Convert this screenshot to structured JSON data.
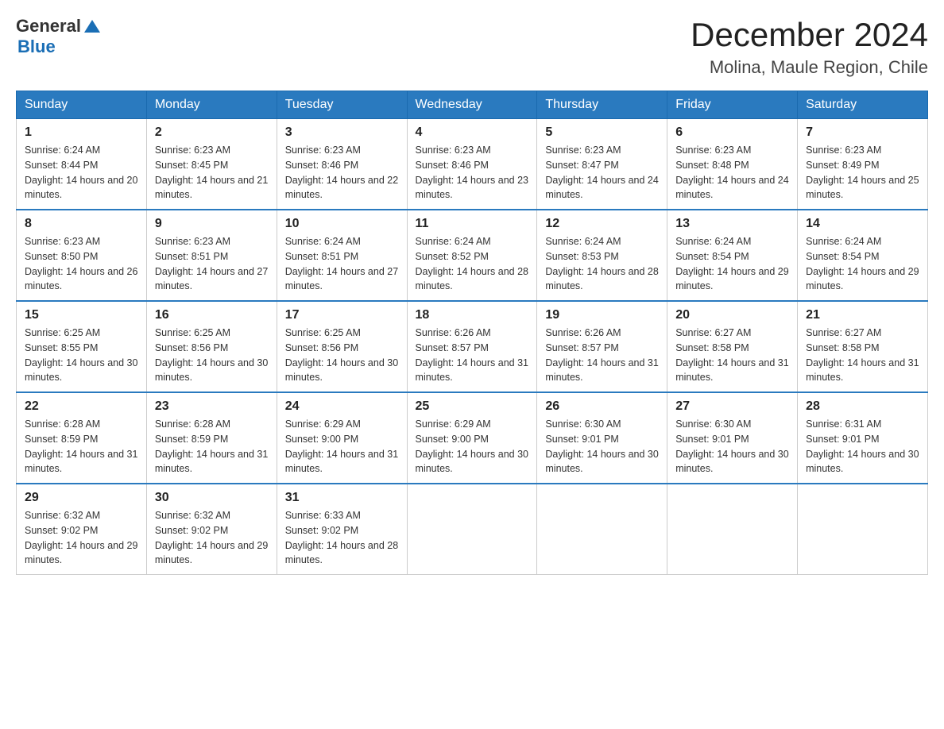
{
  "logo": {
    "text_general": "General",
    "text_blue": "Blue"
  },
  "header": {
    "month_year": "December 2024",
    "location": "Molina, Maule Region, Chile"
  },
  "weekdays": [
    "Sunday",
    "Monday",
    "Tuesday",
    "Wednesday",
    "Thursday",
    "Friday",
    "Saturday"
  ],
  "weeks": [
    [
      {
        "day": "1",
        "sunrise": "6:24 AM",
        "sunset": "8:44 PM",
        "daylight": "14 hours and 20 minutes."
      },
      {
        "day": "2",
        "sunrise": "6:23 AM",
        "sunset": "8:45 PM",
        "daylight": "14 hours and 21 minutes."
      },
      {
        "day": "3",
        "sunrise": "6:23 AM",
        "sunset": "8:46 PM",
        "daylight": "14 hours and 22 minutes."
      },
      {
        "day": "4",
        "sunrise": "6:23 AM",
        "sunset": "8:46 PM",
        "daylight": "14 hours and 23 minutes."
      },
      {
        "day": "5",
        "sunrise": "6:23 AM",
        "sunset": "8:47 PM",
        "daylight": "14 hours and 24 minutes."
      },
      {
        "day": "6",
        "sunrise": "6:23 AM",
        "sunset": "8:48 PM",
        "daylight": "14 hours and 24 minutes."
      },
      {
        "day": "7",
        "sunrise": "6:23 AM",
        "sunset": "8:49 PM",
        "daylight": "14 hours and 25 minutes."
      }
    ],
    [
      {
        "day": "8",
        "sunrise": "6:23 AM",
        "sunset": "8:50 PM",
        "daylight": "14 hours and 26 minutes."
      },
      {
        "day": "9",
        "sunrise": "6:23 AM",
        "sunset": "8:51 PM",
        "daylight": "14 hours and 27 minutes."
      },
      {
        "day": "10",
        "sunrise": "6:24 AM",
        "sunset": "8:51 PM",
        "daylight": "14 hours and 27 minutes."
      },
      {
        "day": "11",
        "sunrise": "6:24 AM",
        "sunset": "8:52 PM",
        "daylight": "14 hours and 28 minutes."
      },
      {
        "day": "12",
        "sunrise": "6:24 AM",
        "sunset": "8:53 PM",
        "daylight": "14 hours and 28 minutes."
      },
      {
        "day": "13",
        "sunrise": "6:24 AM",
        "sunset": "8:54 PM",
        "daylight": "14 hours and 29 minutes."
      },
      {
        "day": "14",
        "sunrise": "6:24 AM",
        "sunset": "8:54 PM",
        "daylight": "14 hours and 29 minutes."
      }
    ],
    [
      {
        "day": "15",
        "sunrise": "6:25 AM",
        "sunset": "8:55 PM",
        "daylight": "14 hours and 30 minutes."
      },
      {
        "day": "16",
        "sunrise": "6:25 AM",
        "sunset": "8:56 PM",
        "daylight": "14 hours and 30 minutes."
      },
      {
        "day": "17",
        "sunrise": "6:25 AM",
        "sunset": "8:56 PM",
        "daylight": "14 hours and 30 minutes."
      },
      {
        "day": "18",
        "sunrise": "6:26 AM",
        "sunset": "8:57 PM",
        "daylight": "14 hours and 31 minutes."
      },
      {
        "day": "19",
        "sunrise": "6:26 AM",
        "sunset": "8:57 PM",
        "daylight": "14 hours and 31 minutes."
      },
      {
        "day": "20",
        "sunrise": "6:27 AM",
        "sunset": "8:58 PM",
        "daylight": "14 hours and 31 minutes."
      },
      {
        "day": "21",
        "sunrise": "6:27 AM",
        "sunset": "8:58 PM",
        "daylight": "14 hours and 31 minutes."
      }
    ],
    [
      {
        "day": "22",
        "sunrise": "6:28 AM",
        "sunset": "8:59 PM",
        "daylight": "14 hours and 31 minutes."
      },
      {
        "day": "23",
        "sunrise": "6:28 AM",
        "sunset": "8:59 PM",
        "daylight": "14 hours and 31 minutes."
      },
      {
        "day": "24",
        "sunrise": "6:29 AM",
        "sunset": "9:00 PM",
        "daylight": "14 hours and 31 minutes."
      },
      {
        "day": "25",
        "sunrise": "6:29 AM",
        "sunset": "9:00 PM",
        "daylight": "14 hours and 30 minutes."
      },
      {
        "day": "26",
        "sunrise": "6:30 AM",
        "sunset": "9:01 PM",
        "daylight": "14 hours and 30 minutes."
      },
      {
        "day": "27",
        "sunrise": "6:30 AM",
        "sunset": "9:01 PM",
        "daylight": "14 hours and 30 minutes."
      },
      {
        "day": "28",
        "sunrise": "6:31 AM",
        "sunset": "9:01 PM",
        "daylight": "14 hours and 30 minutes."
      }
    ],
    [
      {
        "day": "29",
        "sunrise": "6:32 AM",
        "sunset": "9:02 PM",
        "daylight": "14 hours and 29 minutes."
      },
      {
        "day": "30",
        "sunrise": "6:32 AM",
        "sunset": "9:02 PM",
        "daylight": "14 hours and 29 minutes."
      },
      {
        "day": "31",
        "sunrise": "6:33 AM",
        "sunset": "9:02 PM",
        "daylight": "14 hours and 28 minutes."
      },
      null,
      null,
      null,
      null
    ]
  ]
}
